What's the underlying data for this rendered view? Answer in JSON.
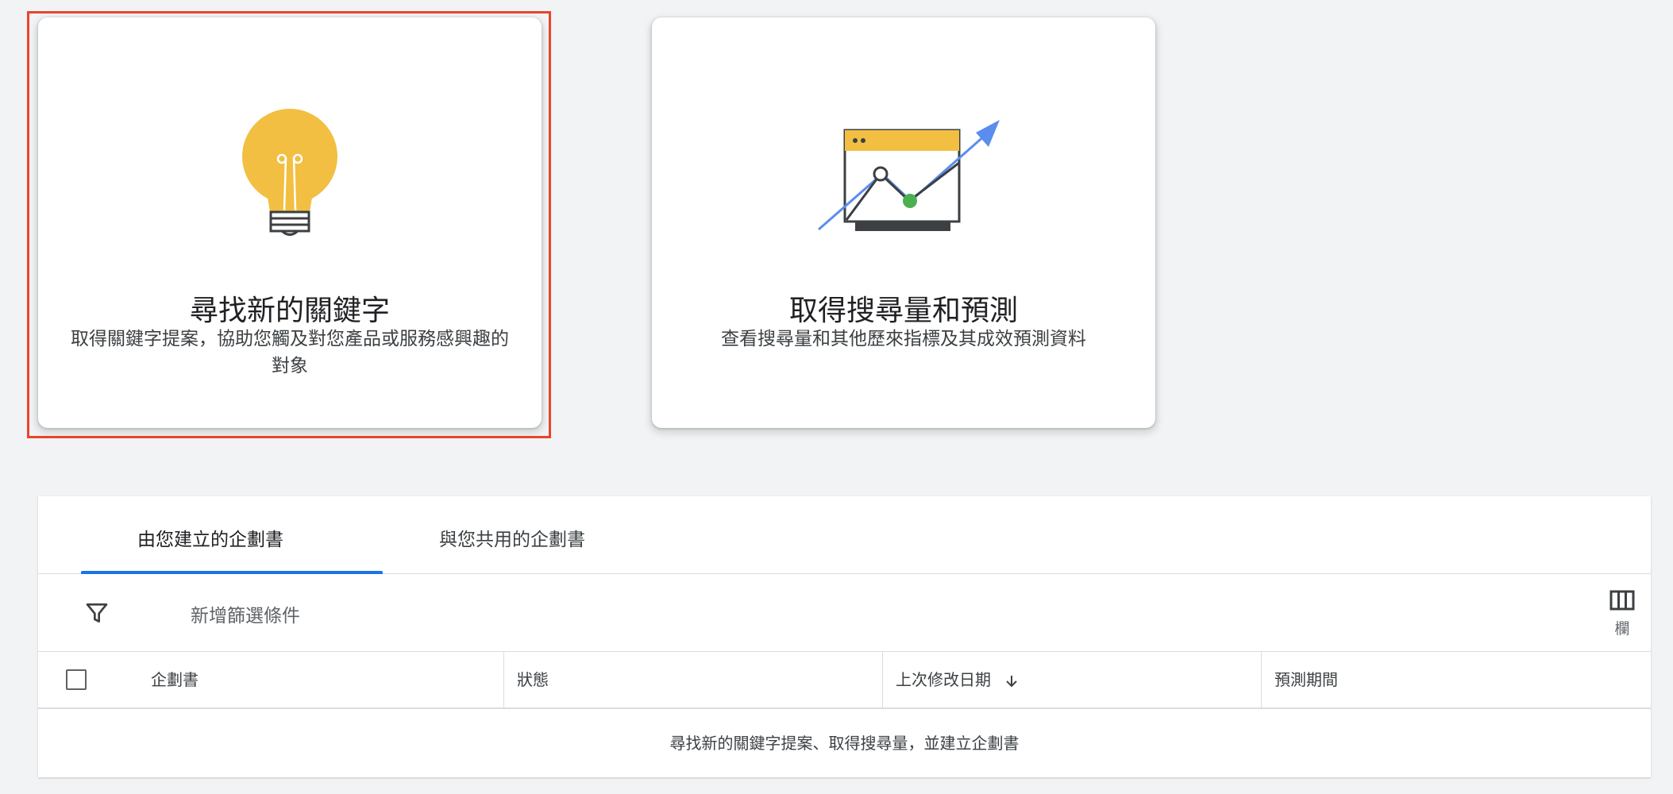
{
  "cards": [
    {
      "title": "尋找新的關鍵字",
      "description": "取得關鍵字提案，協助您觸及對您產品或服務感興趣的對象",
      "icon": "lightbulb-icon"
    },
    {
      "title": "取得搜尋量和預測",
      "description": "查看搜尋量和其他歷來指標及其成效預測資料",
      "icon": "forecast-chart-icon"
    }
  ],
  "tabs": [
    {
      "label": "由您建立的企劃書",
      "active": true
    },
    {
      "label": "與您共用的企劃書",
      "active": false
    }
  ],
  "filter": {
    "label": "新增篩選條件"
  },
  "columns_button": {
    "label": "欄"
  },
  "table": {
    "headers": {
      "plan": "企劃書",
      "status": "狀態",
      "last_modified": "上次修改日期",
      "forecast_period": "預測期間"
    },
    "empty_message": "尋找新的關鍵字提案、取得搜尋量，並建立企劃書"
  },
  "colors": {
    "accent": "#1a73e8",
    "selection": "#e8452c",
    "bulb": "#f2bf42",
    "arrow": "#5b8def",
    "point": "#4caf50"
  }
}
